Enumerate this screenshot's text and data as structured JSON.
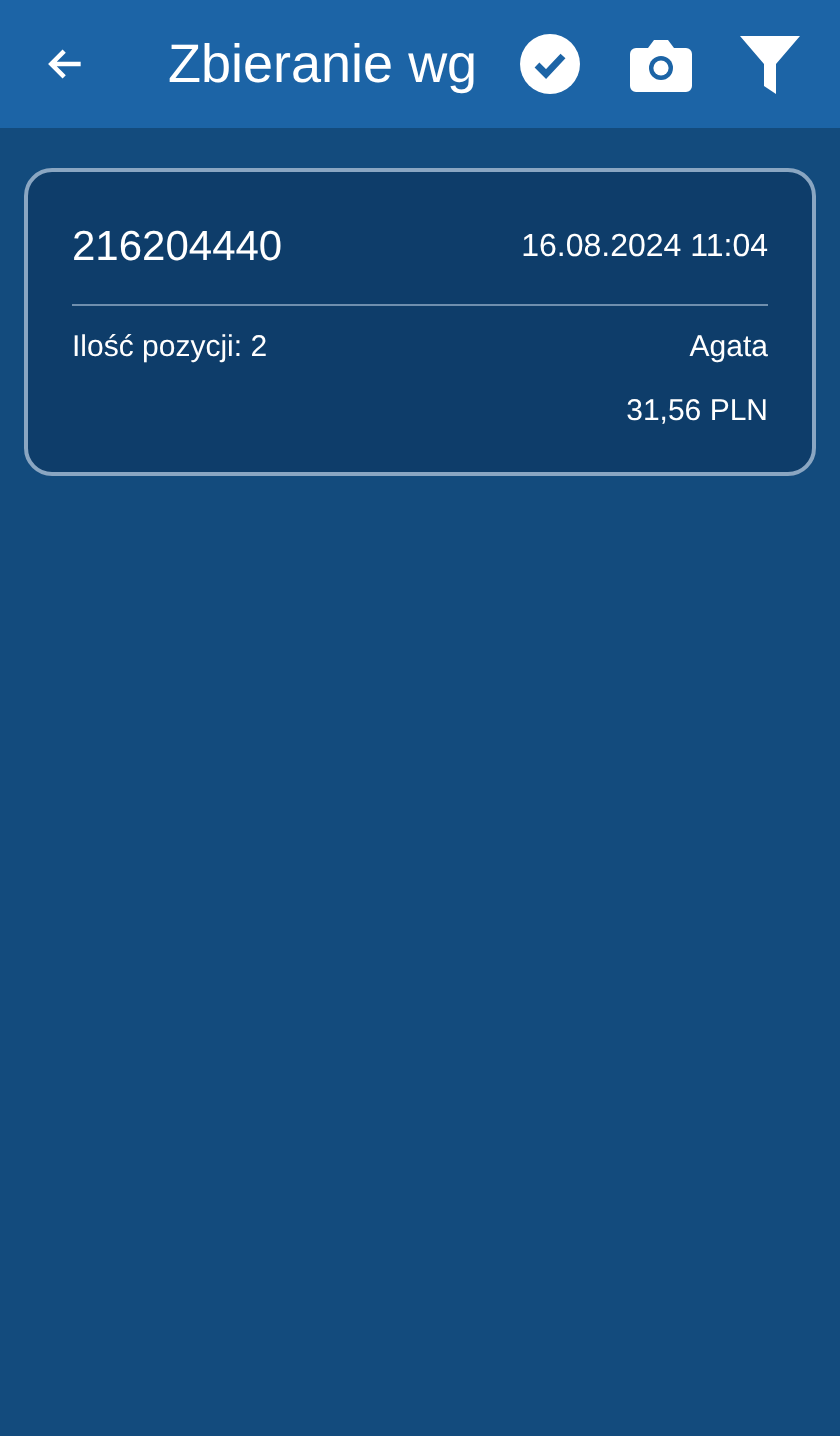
{
  "app_bar": {
    "title": "Zbieranie wg"
  },
  "orders": [
    {
      "number": "216204440",
      "date": "16.08.2024 11:04",
      "items": "Ilość pozycji: 2",
      "person": "Agata",
      "total": "31,56 PLN"
    }
  ]
}
